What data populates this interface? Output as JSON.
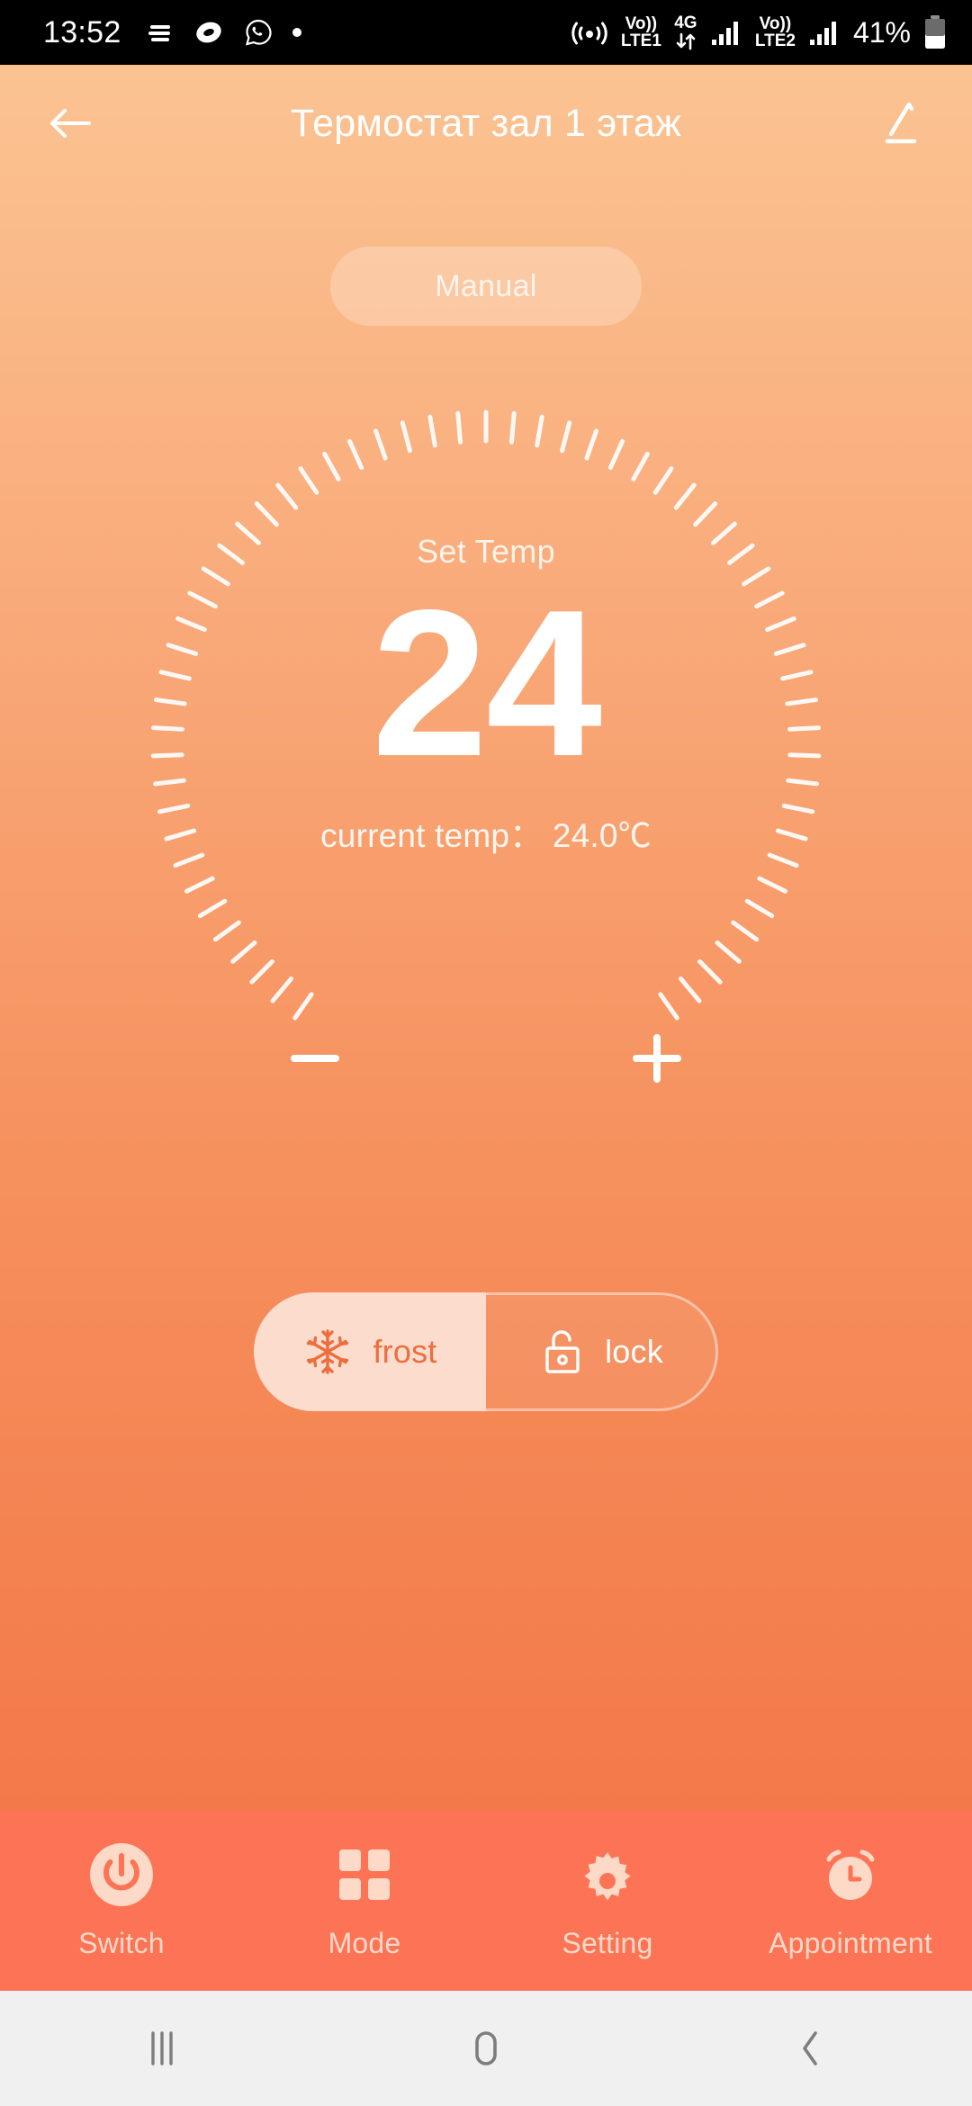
{
  "status_bar": {
    "clock": "13:52",
    "icons_left": [
      "menu-lines-icon",
      "samsung-internet-icon",
      "whatsapp-icon",
      "dot-indicator-icon"
    ],
    "volte1_top": "Vo))",
    "volte1_bottom": "LTE1",
    "network_top": "4G",
    "volte2_top": "Vo))",
    "volte2_bottom": "LTE2",
    "battery_percent": "41%"
  },
  "header": {
    "back_icon": "arrow-left-icon",
    "title": "Термостат зал 1 этаж",
    "edit_icon": "pencil-icon"
  },
  "mode": {
    "label": "Manual"
  },
  "dial": {
    "set_temp_label": "Set Temp",
    "set_temp_value": "24",
    "current_temp": "current temp：  24.0℃",
    "tick_count": 60,
    "gap_degrees": 70
  },
  "adjust": {
    "minus_label": "minus-icon",
    "plus_label": "plus-icon"
  },
  "toggles": [
    {
      "label": "frost",
      "icon": "snowflake-icon",
      "active": true
    },
    {
      "label": "lock",
      "icon": "unlock-icon",
      "active": false
    }
  ],
  "bottom_nav": [
    {
      "label": "Switch",
      "icon": "power-icon"
    },
    {
      "label": "Mode",
      "icon": "grid-squares-icon"
    },
    {
      "label": "Setting",
      "icon": "gear-icon"
    },
    {
      "label": "Appointment",
      "icon": "alarm-clock-icon"
    }
  ],
  "system_nav": [
    {
      "name": "recents-button",
      "icon": "three-bars-icon"
    },
    {
      "name": "home-button",
      "icon": "rounded-rect-icon"
    },
    {
      "name": "back-button",
      "icon": "chevron-left-icon"
    }
  ],
  "colors": {
    "gradient_top": "#FBC392",
    "gradient_bottom": "#F37246",
    "nav_bar": "#FC7455",
    "active_toggle_bg": "#FCDCCC",
    "active_toggle_fg": "#EC6E3E",
    "nav_label": "#FDD9C8",
    "sys_nav_bg": "#F0F0F0"
  }
}
